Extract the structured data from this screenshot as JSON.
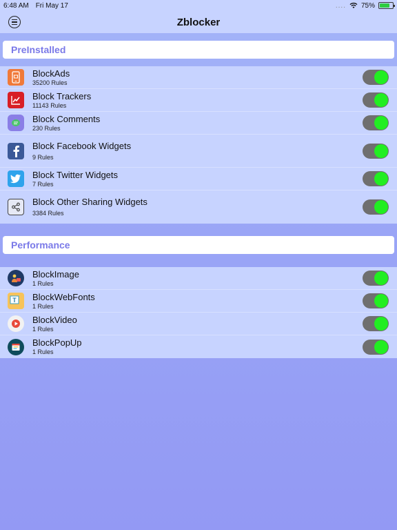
{
  "status_bar": {
    "time": "6:48 AM",
    "date": "Fri May 17",
    "battery": "75%",
    "wifi_icon": "wifi-icon",
    "battery_icon": "battery-icon"
  },
  "nav": {
    "title": "Zblocker",
    "menu_icon": "menu-icon"
  },
  "sections": {
    "preinstalled": {
      "header": "PreInstalled",
      "items": [
        {
          "title": "BlockAds",
          "subtitle": "35200 Rules",
          "icon": "block-ads-icon",
          "enabled": true
        },
        {
          "title": "Block Trackers",
          "subtitle": "11143 Rules",
          "icon": "trackers-icon",
          "enabled": true
        },
        {
          "title": "Block Comments",
          "subtitle": "230 Rules",
          "icon": "comments-icon",
          "enabled": true
        },
        {
          "title": "Block Facebook Widgets",
          "subtitle": "9 Rules",
          "icon": "facebook-icon",
          "enabled": true
        },
        {
          "title": "Block Twitter Widgets",
          "subtitle": "7 Rules",
          "icon": "twitter-icon",
          "enabled": true
        },
        {
          "title": "Block Other Sharing Widgets",
          "subtitle": "3384 Rules",
          "icon": "share-icon",
          "enabled": true
        }
      ]
    },
    "performance": {
      "header": "Performance",
      "items": [
        {
          "title": "BlockImage",
          "subtitle": "1 Rules",
          "icon": "image-icon",
          "enabled": true
        },
        {
          "title": "BlockWebFonts",
          "subtitle": "1 Rules",
          "icon": "web-fonts-icon",
          "enabled": true
        },
        {
          "title": "BlockVideo",
          "subtitle": "1 Rules",
          "icon": "video-icon",
          "enabled": true
        },
        {
          "title": "BlockPopUp",
          "subtitle": "1 Rules",
          "icon": "popup-icon",
          "enabled": true
        }
      ]
    }
  },
  "colors": {
    "accent": "#7a79e8",
    "toggle_on": "#22ee22",
    "toggle_track": "#6f6f6f",
    "list_bg": "#c7d3ff"
  }
}
